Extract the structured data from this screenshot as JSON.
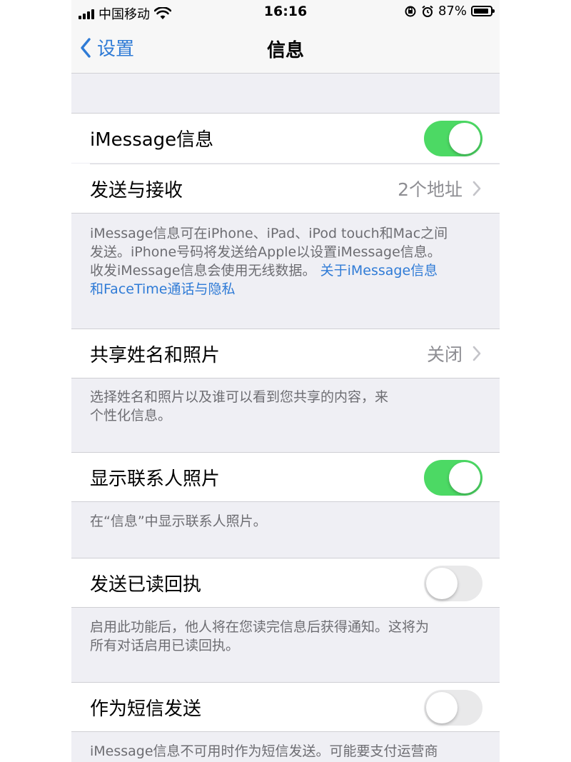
{
  "status_bar": {
    "carrier": "中国移动",
    "time": "16:16",
    "battery_percent": "87%"
  },
  "nav": {
    "back_label": "设置",
    "title": "信息"
  },
  "rows": {
    "imessage": {
      "label": "iMessage信息",
      "toggle": "on"
    },
    "send_receive": {
      "label": "发送与接收",
      "value": "2个地址"
    },
    "share_name": {
      "label": "共享姓名和照片",
      "value": "关闭"
    },
    "show_contact_photos": {
      "label": "显示联系人照片",
      "toggle": "on"
    },
    "read_receipts": {
      "label": "发送已读回执",
      "toggle": "off"
    },
    "send_as_sms": {
      "label": "作为短信发送",
      "toggle": "off"
    }
  },
  "footnotes": {
    "imessage_line1": "iMessage信息可在iPhone、iPad、iPod touch和Mac之间",
    "imessage_line2": "发送。iPhone号码将发送给Apple以设置iMessage信息。",
    "imessage_line3": "收发iMessage信息会使用无线数据。",
    "imessage_link_line3": "关于iMessage信息",
    "imessage_link_line4": "和FaceTime通话与隐私",
    "share_line1": "选择姓名和照片以及谁可以看到您共享的内容，来",
    "share_line2": "个性化信息。",
    "contact_photos": "在“信息”中显示联系人照片。",
    "read_receipts_line1": "启用此功能后，他人将在您读完信息后获得通知。这将为",
    "read_receipts_line2": "所有对话启用已读回执。",
    "sms_line1": "iMessage信息不可用时作为短信发送。可能要支付运营商"
  },
  "colors": {
    "accent": "#2f7bd6",
    "toggle_on": "#4cd964",
    "toggle_off": "#e9e9ea",
    "background": "#efeff4"
  }
}
